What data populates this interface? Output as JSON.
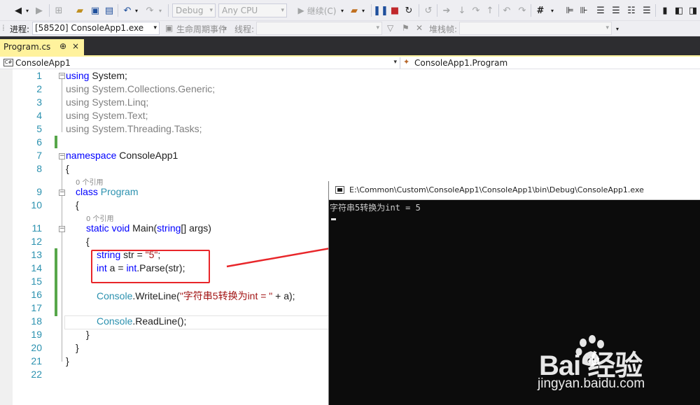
{
  "toolbar": {
    "config": "Debug",
    "platform": "Any CPU",
    "continue_label": "继续(C)"
  },
  "debug_bar": {
    "process_label": "进程:",
    "process_value": "[58520] ConsoleApp1.exe",
    "lifecycle_label": "生命周期事件",
    "thread_label": "线程:",
    "stackframe_label": "堆栈帧:"
  },
  "tab": {
    "title": "Program.cs",
    "pin": "⊕",
    "close": "×"
  },
  "navbar": {
    "project": "ConsoleApp1",
    "class": "ConsoleApp1.Program"
  },
  "editor": {
    "line_numbers": [
      "1",
      "2",
      "3",
      "4",
      "5",
      "6",
      "7",
      "8",
      "9",
      "10",
      "11",
      "12",
      "13",
      "14",
      "15",
      "16",
      "17",
      "18",
      "19",
      "20",
      "21",
      "22"
    ],
    "refs": [
      "0 个引用",
      "0 个引用"
    ],
    "lines": {
      "l1a": "using",
      "l1b": " System;",
      "l2a": "using",
      "l2b": " System.Collections.Generic;",
      "l3a": "using",
      "l3b": " System.Linq;",
      "l4a": "using",
      "l4b": " System.Text;",
      "l5a": "using",
      "l5b": " System.Threading.Tasks;",
      "l7a": "namespace",
      "l7b": " ConsoleApp1",
      "l8": "{",
      "l9a": "class",
      "l9b": "Program",
      "l10": "{",
      "l11a": "static",
      "l11b": "void",
      "l11c": " Main(",
      "l11d": "string",
      "l11e": "[] args)",
      "l12": "{",
      "l13a": "string",
      "l13b": " str = ",
      "l13c": "\"5\"",
      "l13d": ";",
      "l14a": "int",
      "l14b": " a = ",
      "l14c": "int",
      "l14d": ".Parse(str);",
      "l16a": "Console",
      "l16b": ".WriteLine(",
      "l16c": "\"字符串5转换为int = \"",
      "l16d": " + a);",
      "l18a": "Console",
      "l18b": ".ReadLine();",
      "l19": "}",
      "l20": "}",
      "l21": "}"
    }
  },
  "console": {
    "title": "E:\\Common\\Custom\\ConsoleApp1\\ConsoleApp1\\bin\\Debug\\ConsoleApp1.exe",
    "output": "字符串5转换为int = 5"
  },
  "watermark": {
    "logo": "Bai  经验",
    "url": "jingyan.baidu.com"
  }
}
